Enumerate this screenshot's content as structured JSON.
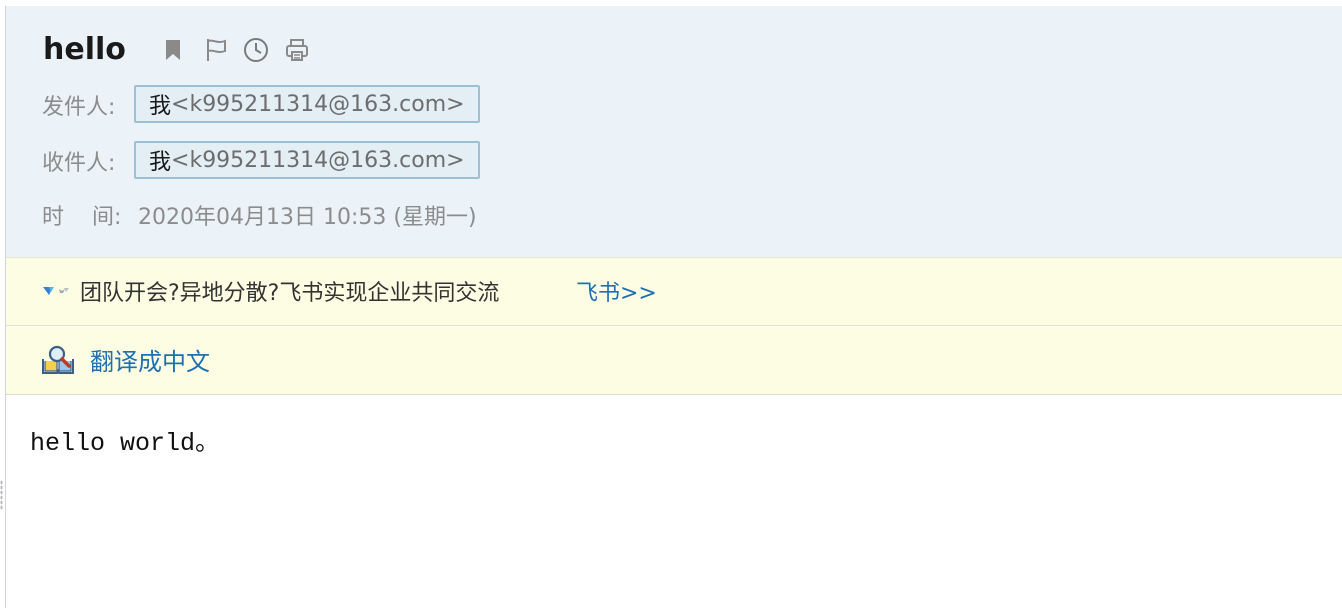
{
  "mail": {
    "subject": "hello",
    "toolbar": {
      "icons": [
        "bookmark-icon",
        "flag-icon",
        "clock-icon",
        "print-icon"
      ]
    },
    "sender": {
      "label": "发件人:",
      "name": "我",
      "email": "<k995211314@163.com>"
    },
    "recipient": {
      "label": "收件人:",
      "name": "我",
      "email": "<k995211314@163.com>"
    },
    "time": {
      "label": "时    间:",
      "value": "2020年04月13日 10:53 (星期一)"
    },
    "ad": {
      "text": "团队开会?异地分散?飞书实现企业共同交流",
      "link": "飞书>>"
    },
    "translate": {
      "link": "翻译成中文"
    },
    "body": "hello world。"
  },
  "colors": {
    "header_bg": "#ebf3f9",
    "banner_bg": "#fdfde3",
    "link": "#1e6fb3",
    "address_border": "#9fc0d2"
  }
}
